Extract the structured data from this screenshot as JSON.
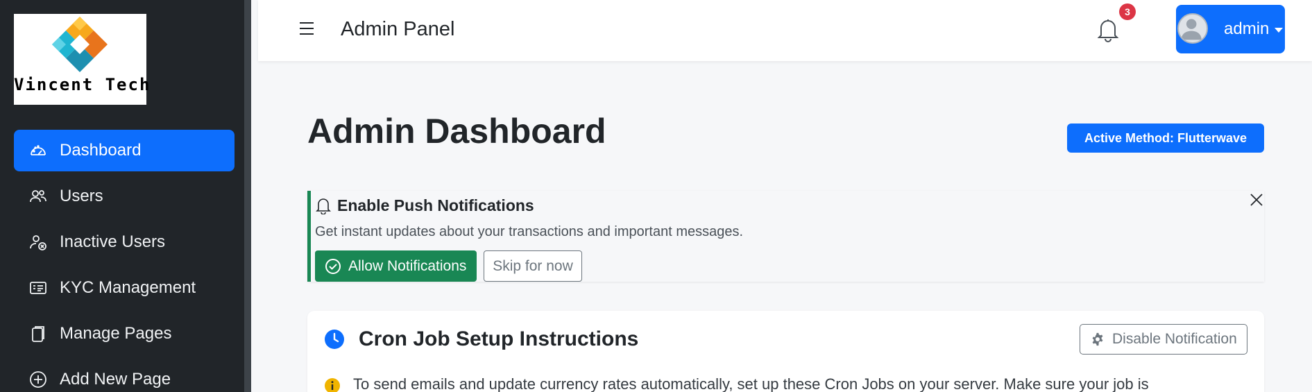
{
  "brand": {
    "logo_text": "Vincent Tech",
    "colors": {
      "diamond_top": "#f7a81b",
      "diamond_left": "#1fb5d1",
      "diamond_right": "#e8741c",
      "diamond_bottom": "#1d8fb0"
    }
  },
  "sidebar": {
    "items": [
      {
        "label": "Dashboard",
        "icon": "speedometer-icon",
        "active": true
      },
      {
        "label": "Users",
        "icon": "people-icon"
      },
      {
        "label": "Inactive Users",
        "icon": "person-x-icon"
      },
      {
        "label": "KYC Management",
        "icon": "id-card-icon"
      },
      {
        "label": "Manage Pages",
        "icon": "files-icon"
      },
      {
        "label": "Add New Page",
        "icon": "plus-circle-icon"
      }
    ]
  },
  "topbar": {
    "title": "Admin Panel",
    "notification_count": "3",
    "user_name": "admin"
  },
  "main": {
    "page_title": "Admin Dashboard",
    "method_badge": "Active Method: Flutterwave",
    "push_card": {
      "title": "Enable Push Notifications",
      "description": "Get instant updates about your transactions and important messages.",
      "allow_label": "Allow Notifications",
      "skip_label": "Skip for now"
    },
    "cron_card": {
      "title": "Cron Job Setup Instructions",
      "disable_label": "Disable Notification",
      "description": "To send emails and update currency rates automatically, set up these Cron Jobs on your server. Make sure your job is"
    }
  },
  "theme": {
    "primary": "#0d6efd",
    "success": "#198754",
    "danger": "#dc3545",
    "warning": "#f0b400",
    "sidebar_bg": "#212529"
  }
}
